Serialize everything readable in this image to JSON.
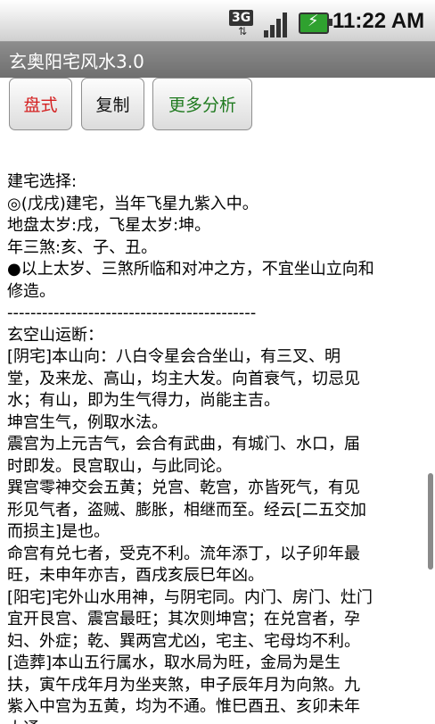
{
  "status_bar": {
    "network_label": "3G",
    "network_arrows": "⇅",
    "time": "11:22 AM",
    "battery_bolt": "⚡",
    "icons": [
      "network-3g-icon",
      "signal-strength-icon",
      "battery-charging-icon"
    ]
  },
  "app": {
    "title": "玄奥阳宅风水3.0"
  },
  "toolbar": {
    "buttons": [
      {
        "label": "盘式",
        "color": "#d42020"
      },
      {
        "label": "复制",
        "color": "#111111"
      },
      {
        "label": "更多分析",
        "color": "#1f7a1f"
      }
    ]
  },
  "content": {
    "lines": [
      "建宅选择:",
      "◎(戊戌)建宅，当年飞星九紫入中。",
      "  地盘太岁:戌，飞星太岁:坤。",
      "  年三煞:亥、子、丑。",
      "●以上太岁、三煞所临和对冲之方，不宜坐山立向和",
      "修造。",
      "-------------------------------------------",
      "玄空山运断：",
      "[阴宅]本山向：八白令星会合坐山，有三叉、明",
      "堂，及来龙、高山，均主大发。向首衰气，切忌见",
      "水；有山，即为生气得力，尚能主吉。",
      "坤宫生气，例取水法。",
      "震宫为上元吉气，会合有武曲，有城门、水口，届",
      "时即发。艮宫取山，与此同论。",
      "巽宫零神交会五黄；兑宫、乾宫，亦皆死气，有见",
      "形见气者，盗贼、膨胀，相继而至。经云[二五交加",
      "而损主]是也。",
      "命宫有兑七者，受克不利。流年添丁，以子卯年最",
      "旺，未申年亦吉，酉戌亥辰巳年凶。",
      "[阳宅]宅外山水用神，与阴宅同。内门、房门、灶门",
      "宜开艮宫、震宫最旺；其次则坤宫；在兑宫者，孕",
      "妇、外症；乾、巽两宫尤凶，宅主、宅母均不利。",
      "[造葬]本山五行属水，取水局为旺，金局为是生",
      "扶，寅午戌年月为坐夹煞，申子辰年月为向煞。九",
      "紫入中宫为五黄，均为不通。惟巳酉丑、亥卯未年",
      "大通"
    ]
  }
}
